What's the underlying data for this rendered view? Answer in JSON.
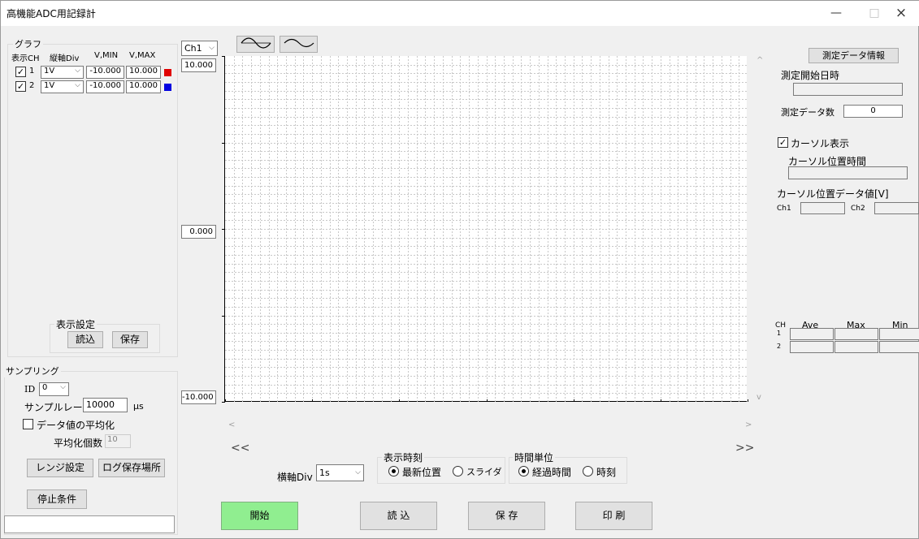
{
  "window": {
    "title": "高機能ADC用記録計",
    "min": "—",
    "max": "□",
    "close": "×"
  },
  "graph": {
    "group_label": "グラフ",
    "col_show": "表示CH",
    "col_div": "縦軸Div",
    "col_vmin": "V,MIN",
    "col_vmax": "V,MAX",
    "rows": [
      {
        "ch": "1",
        "div": "1V",
        "vmin": "-10.000",
        "vmax": "10.000",
        "color": "#e00000"
      },
      {
        "ch": "2",
        "div": "1V",
        "vmin": "-10.000",
        "vmax": "10.000",
        "color": "#0000e0"
      }
    ],
    "display_group": "表示設定",
    "read_btn": "読込",
    "save_btn": "保存"
  },
  "sampling": {
    "group_label": "サンプリング",
    "id_label": "ID",
    "id_value": "0",
    "rate_label": "サンプルレート",
    "rate_value": "10000",
    "rate_unit": "μs",
    "avg_label": "データ値の平均化",
    "avg_count_label": "平均化個数",
    "avg_count_value": "10",
    "range_btn": "レンジ設定",
    "logdir_btn": "ログ保存場所",
    "stop_btn": "停止条件",
    "status": ""
  },
  "chart_area": {
    "ch_select": "Ch1",
    "y_top": "10.000",
    "y_mid": "0.000",
    "y_bottom": "-10.000",
    "nav_left": "<<",
    "nav_right": ">>",
    "scroll_left": "<",
    "scroll_right": ">",
    "scroll_up": "^",
    "scroll_down": "v",
    "haxis_label": "横軸Div",
    "haxis_value": "1s",
    "time_group": "表示時刻",
    "time_opt1": "最新位置",
    "time_opt2": "スライダ",
    "unit_group": "時間単位",
    "unit_opt1": "経過時間",
    "unit_opt2": "時刻"
  },
  "bottom_buttons": {
    "start": "開始",
    "read": "読 込",
    "save": "保 存",
    "print": "印 刷",
    "start_color": "#90ee90"
  },
  "info": {
    "info_btn": "測定データ情報",
    "start_time_label": "測定開始日時",
    "start_time_value": "",
    "count_label": "測定データ数",
    "count_value": "0",
    "cursor_label": "カーソル表示",
    "cursor_time_label": "カーソル位置時間",
    "cursor_time_value": "",
    "cursor_value_label": "カーソル位置データ値[V]",
    "ch1_label": "Ch1",
    "ch2_label": "Ch2",
    "ch1_value": "",
    "ch2_value": "",
    "stats_ch": "CH",
    "stats_ave": "Ave",
    "stats_max": "Max",
    "stats_min": "Min",
    "stats_rows": [
      "1",
      "2"
    ]
  }
}
